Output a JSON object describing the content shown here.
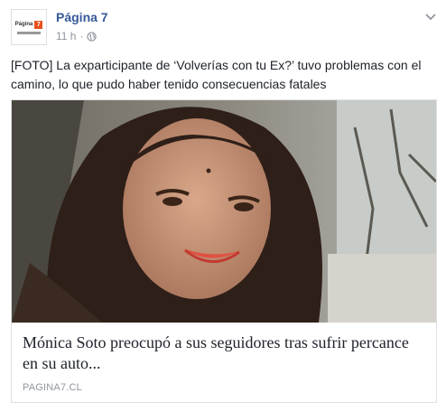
{
  "post": {
    "page_name": "Página 7",
    "time": "11 h",
    "separator": "·",
    "caption": "[FOTO] La exparticipante de ‘Volverías con tu Ex?’ tuvo problemas con el camino, lo que pudo haber tenido consecuencias fatales"
  },
  "avatar": {
    "logo_text": "Página",
    "logo_number": "7"
  },
  "link_card": {
    "title": "Mónica Soto preocupó a sus seguidores tras sufrir percance en su auto...",
    "domain": "PAGINA7.CL"
  },
  "colors": {
    "link_blue": "#365899",
    "meta_gray": "#90949c",
    "brand_orange": "#e8501c"
  },
  "icons": [
    "globe-icon",
    "chevron-down-icon"
  ]
}
